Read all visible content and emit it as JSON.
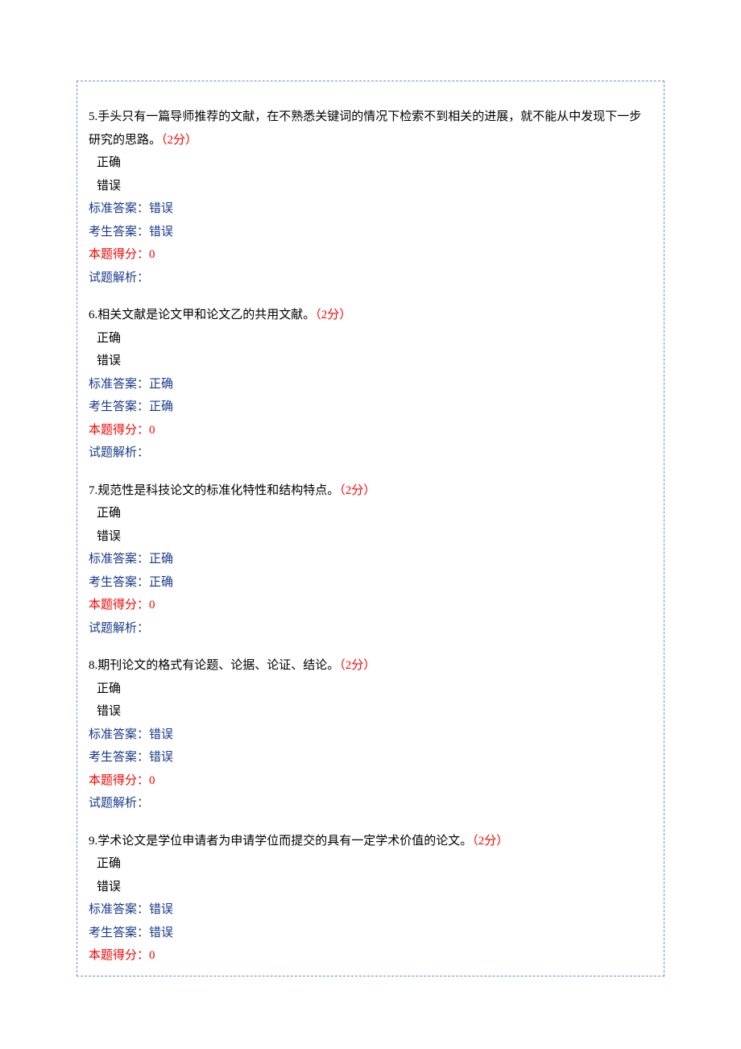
{
  "labels": {
    "standard_answer_label": "标准答案：",
    "student_answer_label": "考生答案：",
    "score_label": "本题得分：",
    "analysis_label": "试题解析："
  },
  "options": {
    "correct": "正确",
    "incorrect": "错误"
  },
  "questions": [
    {
      "number": "5.",
      "text": "手头只有一篇导师推荐的文献，在不熟悉关键词的情况下检索不到相关的进展，就不能从中发现下一步研究的思路。",
      "points": "（2分）",
      "standard_answer": "错误",
      "student_answer": "错误",
      "score": "0",
      "analysis": "",
      "show_analysis": true
    },
    {
      "number": "6.",
      "text": "相关文献是论文甲和论文乙的共用文献。",
      "points": "（2分）",
      "standard_answer": "正确",
      "student_answer": "正确",
      "score": "0",
      "analysis": "",
      "show_analysis": true
    },
    {
      "number": "7.",
      "text": "规范性是科技论文的标准化特性和结构特点。",
      "points": "（2分）",
      "standard_answer": "正确",
      "student_answer": "正确",
      "score": "0",
      "analysis": "",
      "show_analysis": true
    },
    {
      "number": "8.",
      "text": "期刊论文的格式有论题、论据、论证、结论。",
      "points": "（2分）",
      "standard_answer": "错误",
      "student_answer": "错误",
      "score": "0",
      "analysis": "",
      "show_analysis": true
    },
    {
      "number": "9.",
      "text": "学术论文是学位申请者为申请学位而提交的具有一定学术价值的论文。",
      "points": "（2分）",
      "standard_answer": "错误",
      "student_answer": "错误",
      "score": "0",
      "analysis": "",
      "show_analysis": false
    }
  ]
}
